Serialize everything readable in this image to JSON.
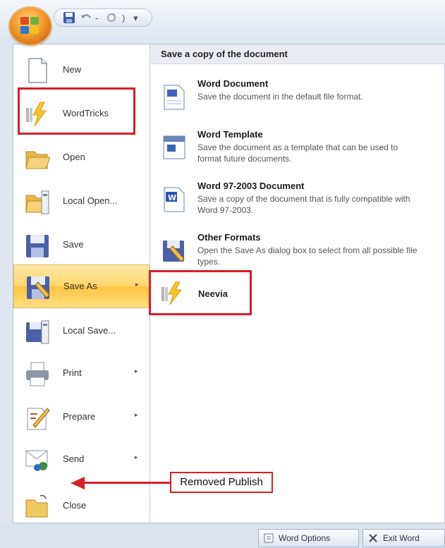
{
  "qat": {
    "save_icon": "save-icon",
    "undo_icon": "undo-icon",
    "sep1": "-",
    "redo_icon": "redo-icon",
    "sep2": ")",
    "customize": "▾"
  },
  "left_menu": {
    "items": [
      {
        "label": "New",
        "icon": "new-document-icon"
      },
      {
        "label": "WordTricks",
        "icon": "lightning-icon"
      },
      {
        "label": "Open",
        "icon": "open-folder-icon"
      },
      {
        "label": "Local Open...",
        "icon": "local-open-icon"
      },
      {
        "label": "Save",
        "icon": "save-icon"
      },
      {
        "label": "Save As",
        "icon": "save-as-icon",
        "arrow": "▸"
      },
      {
        "label": "Local Save...",
        "icon": "local-save-icon"
      },
      {
        "label": "Print",
        "icon": "printer-icon",
        "arrow": "▸"
      },
      {
        "label": "Prepare",
        "icon": "prepare-icon",
        "arrow": "▸"
      },
      {
        "label": "Send",
        "icon": "send-icon",
        "arrow": "▸"
      },
      {
        "label": "Close",
        "icon": "close-folder-icon"
      }
    ]
  },
  "right_pane": {
    "header": "Save a copy of the document",
    "options": [
      {
        "title": "Word Document",
        "desc": "Save the document in the default file format."
      },
      {
        "title": "Word Template",
        "desc": "Save the document as a template that can be used to format future documents."
      },
      {
        "title": "Word 97-2003 Document",
        "desc": "Save a copy of the document that is fully compatible with Word 97-2003."
      },
      {
        "title": "Other Formats",
        "desc": "Open the Save As dialog box to select from all possible file types."
      }
    ],
    "neevia": "Neevia"
  },
  "annotation": {
    "callout": "Removed Publish"
  },
  "bottom": {
    "word_options": "Word Options",
    "exit_word": "Exit Word"
  },
  "colors": {
    "highlight_red": "#d81e2a",
    "active_item": "#ffd56a",
    "office_orange": "#f59b2a"
  }
}
